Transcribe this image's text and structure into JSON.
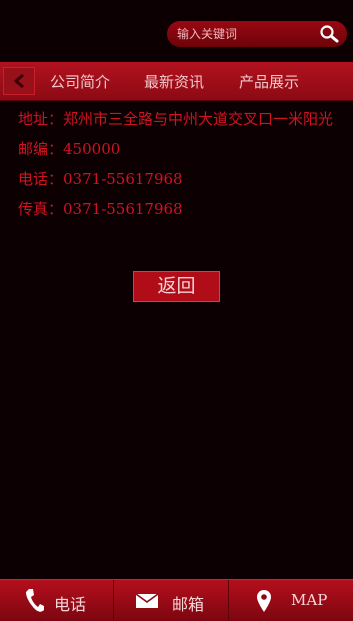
{
  "search": {
    "placeholder": "输入关键词",
    "icon": "search-icon"
  },
  "nav": {
    "back_icon": "chevron-left-icon",
    "tabs": [
      {
        "label": "公司简介"
      },
      {
        "label": "最新资讯"
      },
      {
        "label": "产品展示"
      }
    ]
  },
  "contact": {
    "address_label": "地址：",
    "address_value": "郑州市三全路与中州大道交叉口一米阳光",
    "zip_label": "邮编：",
    "zip_value": "450000",
    "phone_label": "电话：",
    "phone_value": "0371-55617968",
    "fax_label": "传真：",
    "fax_value": "0371-55617968"
  },
  "actions": {
    "back_label": "返回"
  },
  "footer": {
    "items": [
      {
        "label": "电话",
        "icon": "phone-icon"
      },
      {
        "label": "邮箱",
        "icon": "mail-icon"
      },
      {
        "label": "MAP",
        "icon": "map-pin-icon"
      }
    ]
  },
  "colors": {
    "accent": "#b00d19",
    "text_red": "#cf1322",
    "background": "#0c0003"
  }
}
